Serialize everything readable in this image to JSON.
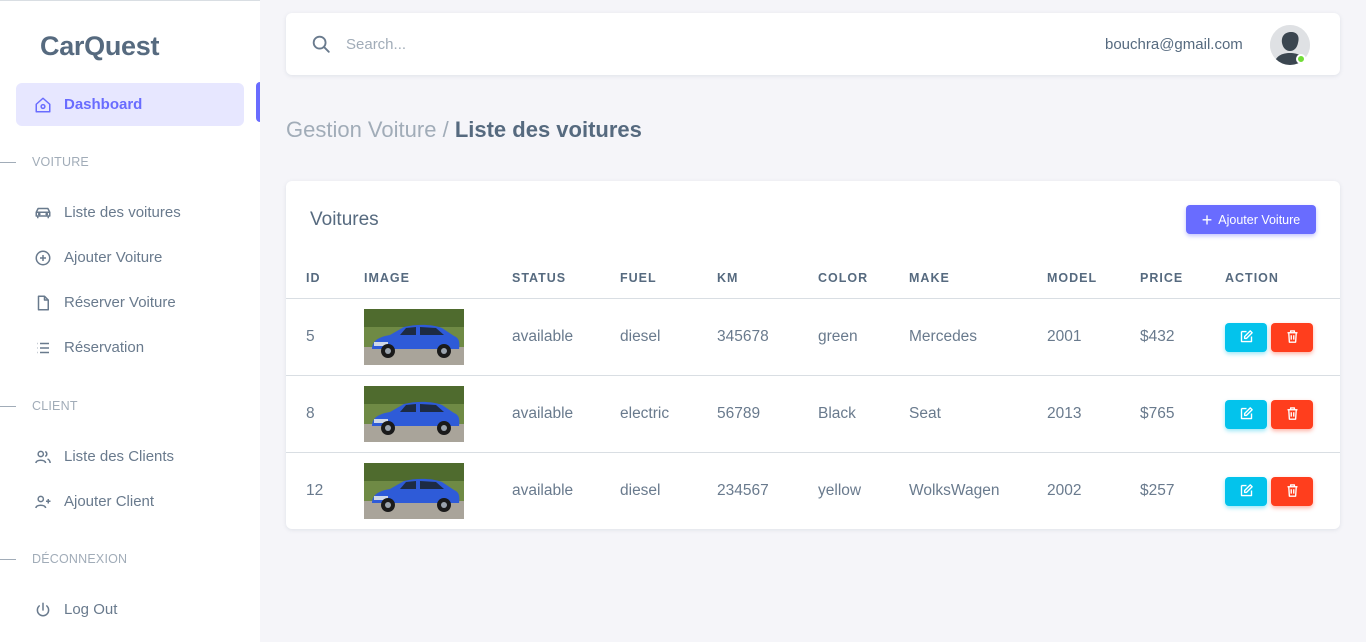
{
  "brand": "CarQuest",
  "sidebar": {
    "dashboard": "Dashboard",
    "sections": [
      {
        "header": "VOITURE",
        "items": [
          "Liste des voitures",
          "Ajouter Voiture",
          "Réserver Voiture",
          "Réservation"
        ]
      },
      {
        "header": "CLIENT",
        "items": [
          "Liste des Clients",
          "Ajouter Client"
        ]
      },
      {
        "header": "DÉCONNEXION",
        "items": [
          "Log Out"
        ]
      }
    ]
  },
  "navbar": {
    "search_placeholder": "Search...",
    "user_email": "bouchra@gmail.com"
  },
  "breadcrumb": {
    "parent": "Gestion Voiture",
    "separator": "/",
    "current": "Liste des voitures"
  },
  "card": {
    "title": "Voitures",
    "add_button": "Ajouter Voiture"
  },
  "table": {
    "headers": [
      "ID",
      "IMAGE",
      "STATUS",
      "FUEL",
      "KM",
      "COLOR",
      "MAKE",
      "MODEL",
      "PRICE",
      "ACTION"
    ],
    "rows": [
      {
        "id": "5",
        "status": "available",
        "fuel": "diesel",
        "km": "345678",
        "color": "green",
        "make": "Mercedes",
        "model": "2001",
        "price": "$432"
      },
      {
        "id": "8",
        "status": "available",
        "fuel": "electric",
        "km": "56789",
        "color": "Black",
        "make": "Seat",
        "model": "2013",
        "price": "$765"
      },
      {
        "id": "12",
        "status": "available",
        "fuel": "diesel",
        "km": "234567",
        "color": "yellow",
        "make": "WolksWagen",
        "model": "2002",
        "price": "$257"
      }
    ]
  },
  "colors": {
    "primary": "#696cff",
    "info": "#03c3ec",
    "danger": "#ff3e1d",
    "online": "#71dd37"
  },
  "icons": {
    "search": "search-icon",
    "dashboard": "home-icon",
    "cars": "car-icon",
    "add": "plus-circle-icon",
    "reserve": "file-icon",
    "reservations": "list-icon",
    "clients": "users-icon",
    "add_client": "user-plus-icon",
    "logout": "power-icon",
    "edit": "edit-icon",
    "delete": "trash-icon"
  }
}
